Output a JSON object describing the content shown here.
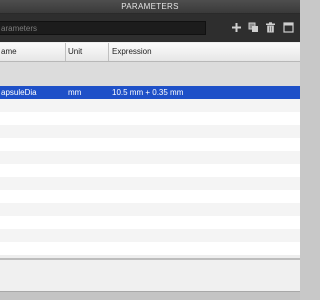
{
  "window": {
    "title": "PARAMETERS"
  },
  "toolbar": {
    "search_placeholder": "arameters",
    "icons": [
      "plus-icon",
      "copy-icon",
      "trash-icon",
      "window-icon"
    ]
  },
  "table": {
    "columns": [
      "ame",
      "Unit",
      "Expression"
    ],
    "selected_row": {
      "name": "apsuleDia",
      "unit": "mm",
      "expression": "10.5 mm + 0.35 mm"
    }
  },
  "colors": {
    "selection": "#1e50c8",
    "toolbar_bg": "#2e2e2e",
    "title_bg": "#444444"
  }
}
